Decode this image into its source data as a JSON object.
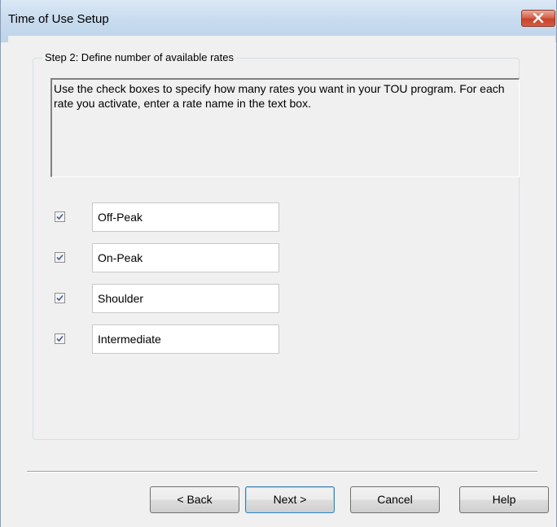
{
  "window": {
    "title": "Time of Use Setup"
  },
  "step": {
    "legend": "Step 2: Define number of available rates",
    "instructions": "Use the check boxes to specify how many rates you want in your TOU program.  For each rate you activate, enter a rate name in the text box."
  },
  "rates": [
    {
      "checked": true,
      "value": "Off-Peak"
    },
    {
      "checked": true,
      "value": "On-Peak"
    },
    {
      "checked": true,
      "value": "Shoulder"
    },
    {
      "checked": true,
      "value": "Intermediate"
    }
  ],
  "buttons": {
    "back": "< Back",
    "next": "Next >",
    "cancel": "Cancel",
    "help": "Help"
  },
  "colors": {
    "titlebar": "#c9dcef",
    "close": "#c7432b",
    "dialog_bg": "#f0f0f0"
  }
}
